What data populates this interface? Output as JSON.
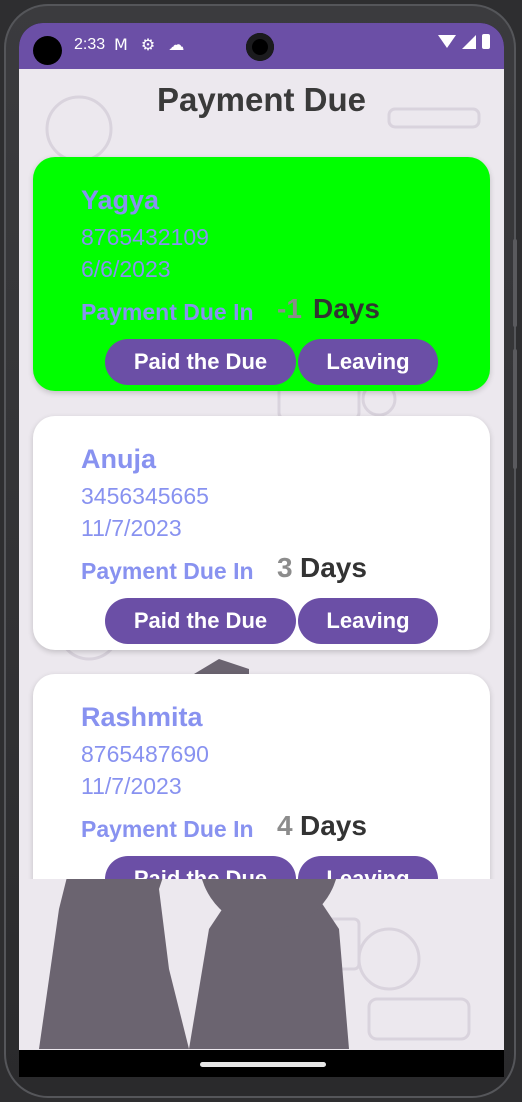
{
  "status_bar": {
    "time": "2:33",
    "icons": [
      "gmail-icon",
      "settings-icon",
      "cloud-icon"
    ],
    "right_icons": [
      "wifi-icon",
      "signal-icon",
      "battery-icon"
    ]
  },
  "page": {
    "title": "Payment Due"
  },
  "colors": {
    "primary": "#6b4fa6",
    "name_text": "#8892f0",
    "highlight_card": "#00ff00",
    "background": "#ece8ee"
  },
  "cards": [
    {
      "name": "Yagya",
      "phone": "8765432109",
      "date": "6/6/2023",
      "due_label": "Payment Due In",
      "due_value": "-1",
      "due_unit": "Days",
      "paid_label": "Paid the Due",
      "leave_label": "Leaving",
      "highlighted": true
    },
    {
      "name": "Anuja",
      "phone": "3456345665",
      "date": "11/7/2023",
      "due_label": "Payment Due In",
      "due_value": "3",
      "due_unit": "Days",
      "paid_label": "Paid the Due",
      "leave_label": "Leaving",
      "highlighted": false
    },
    {
      "name": "Rashmita",
      "phone": "8765487690",
      "date": "11/7/2023",
      "due_label": "Payment Due In",
      "due_value": "4",
      "due_unit": "Days",
      "paid_label": "Paid the Due",
      "leave_label": "Leaving",
      "highlighted": false
    }
  ]
}
